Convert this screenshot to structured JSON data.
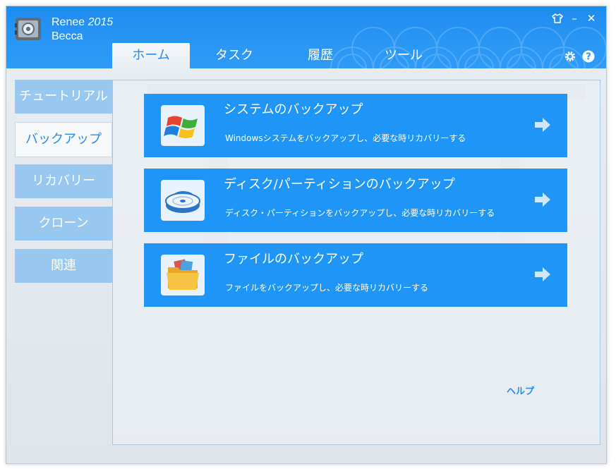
{
  "app": {
    "name": "Renee",
    "version": "2015",
    "user": "Becca"
  },
  "window_controls": {
    "skin_icon": "shirt-icon",
    "minimize_label": "–",
    "close_label": "✕"
  },
  "tabs": [
    {
      "label": "ホーム",
      "active": true
    },
    {
      "label": "タスク",
      "active": false
    },
    {
      "label": "履歴",
      "active": false
    },
    {
      "label": "ツール",
      "active": false
    }
  ],
  "header_icons": [
    "gear-icon",
    "help-icon"
  ],
  "sidebar": {
    "items": [
      {
        "label": "チュートリアル",
        "active": false
      },
      {
        "label": "バックアップ",
        "active": true
      },
      {
        "label": "リカバリー",
        "active": false
      },
      {
        "label": "クローン",
        "active": false
      },
      {
        "label": "関連",
        "active": false
      }
    ]
  },
  "cards": [
    {
      "title": "システムのバックアップ",
      "description": "Windowsシステムをバックアップし、必要な時リカバリーする",
      "icon": "windows-logo-icon"
    },
    {
      "title": "ディスク/パーティションのバックアップ",
      "description": "ディスク・パーティションをバックアップし、必要な時リカバリーする",
      "icon": "hard-disk-icon"
    },
    {
      "title": "ファイルのバックアップ",
      "description": "ファイルをバックアップし、必要な時リカバリーする",
      "icon": "folder-icon"
    }
  ],
  "help_link": "ヘルプ",
  "colors": {
    "title_bar": "#2a97f5",
    "card": "#1f96f7",
    "accent_text": "#2a8be8"
  }
}
